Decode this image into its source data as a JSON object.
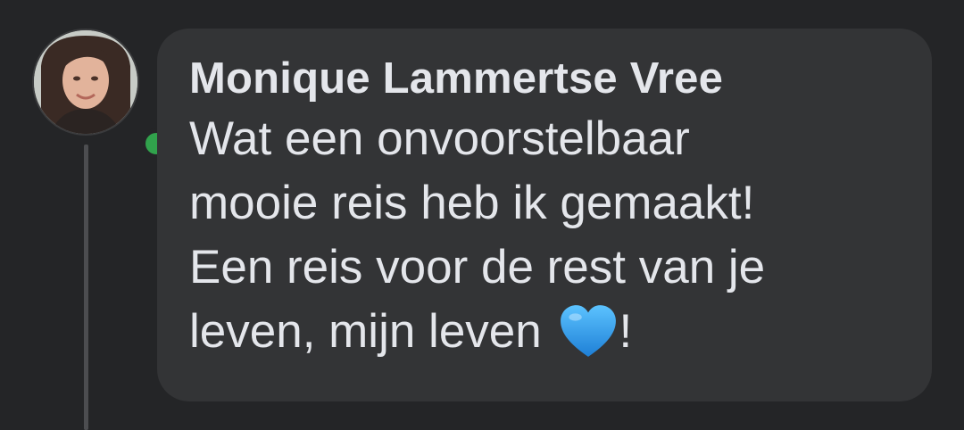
{
  "comment": {
    "author_name": "Monique Lammertse Vree",
    "text_lines": [
      "Wat een onvoorstelbaar",
      "mooie reis heb ik gemaakt!",
      "Een reis voor de rest van je",
      "leven, mijn leven"
    ],
    "trailing_text": "!",
    "emoji": "blue-heart-icon",
    "online_status": "online"
  },
  "colors": {
    "background": "#242527",
    "bubble": "#333436",
    "text": "#e4e6eb",
    "online": "#31a24c",
    "heart": "#3fa9f5"
  }
}
